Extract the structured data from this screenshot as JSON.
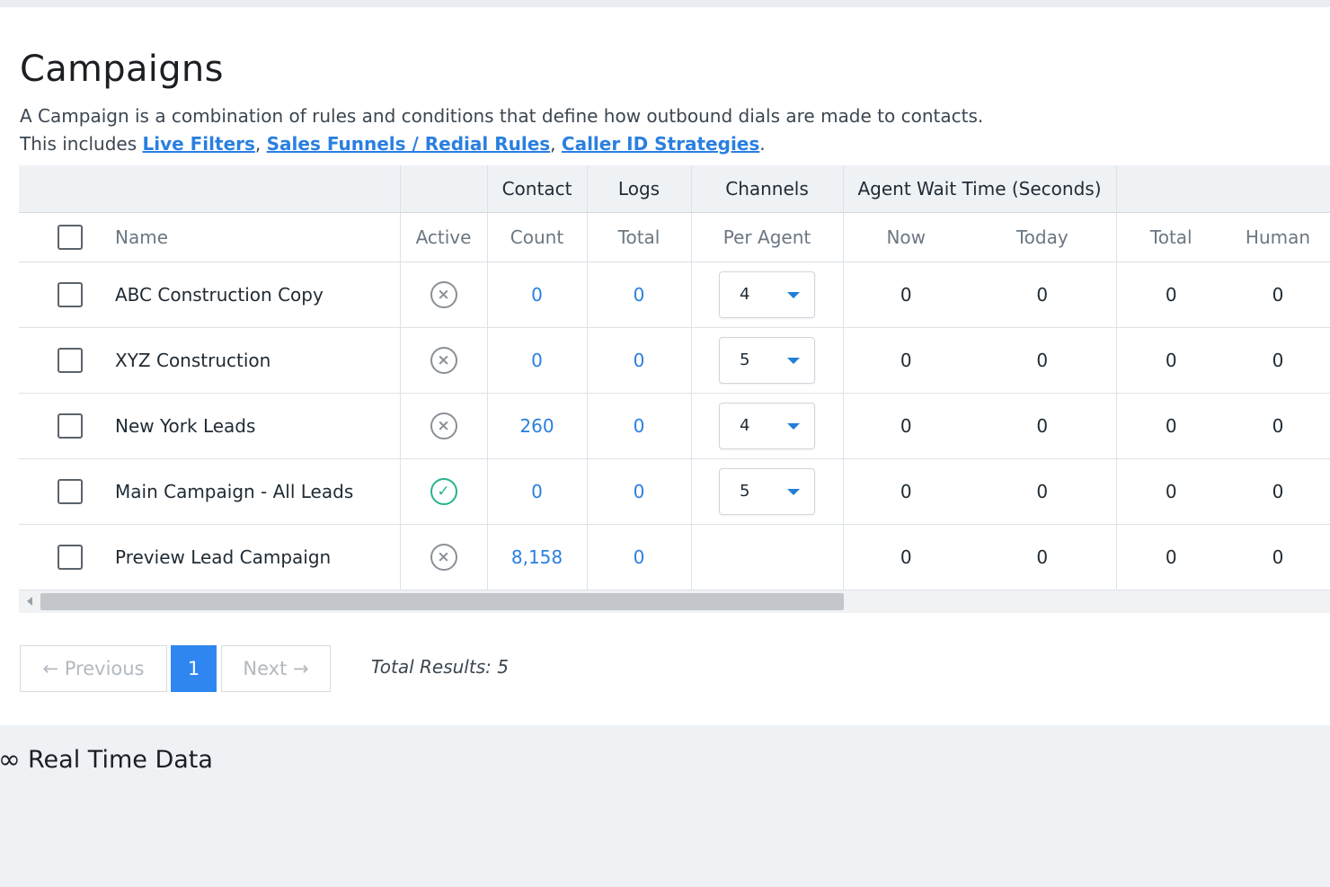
{
  "page": {
    "title": "Campaigns",
    "description_line1": "A Campaign is a combination of rules and conditions that define how outbound dials are made to contacts.",
    "description_prefix": "This includes",
    "links": [
      "Live Filters",
      "Sales Funnels / Redial Rules",
      "Caller ID Strategies"
    ]
  },
  "table": {
    "group_headers": {
      "contact": "Contact",
      "logs": "Logs",
      "channels": "Channels",
      "agent_wait": "Agent Wait Time (Seconds)"
    },
    "column_headers": {
      "name": "Name",
      "active": "Active",
      "count": "Count",
      "total": "Total",
      "per_agent": "Per Agent",
      "now": "Now",
      "today": "Today",
      "total2": "Total",
      "human": "Human"
    },
    "rows": [
      {
        "name": "ABC Construction Copy",
        "active": false,
        "contact_count": "0",
        "logs_total": "0",
        "per_agent": "4",
        "now": "0",
        "today": "0",
        "total": "0",
        "human": "0"
      },
      {
        "name": "XYZ Construction",
        "active": false,
        "contact_count": "0",
        "logs_total": "0",
        "per_agent": "5",
        "now": "0",
        "today": "0",
        "total": "0",
        "human": "0"
      },
      {
        "name": "New York Leads",
        "active": false,
        "contact_count": "260",
        "logs_total": "0",
        "per_agent": "4",
        "now": "0",
        "today": "0",
        "total": "0",
        "human": "0"
      },
      {
        "name": "Main Campaign - All Leads",
        "active": true,
        "contact_count": "0",
        "logs_total": "0",
        "per_agent": "5",
        "now": "0",
        "today": "0",
        "total": "0",
        "human": "0"
      },
      {
        "name": "Preview Lead Campaign",
        "active": false,
        "contact_count": "8,158",
        "logs_total": "0",
        "per_agent": "",
        "now": "0",
        "today": "0",
        "total": "0",
        "human": "0"
      }
    ]
  },
  "pagination": {
    "previous": "← Previous",
    "current": "1",
    "next": "Next →",
    "total_results": "Total Results: 5"
  },
  "footer": {
    "section_title": "Real Time Data"
  },
  "colors": {
    "link": "#2a7fe0",
    "active_page": "#2f86f0",
    "active_status": "#26b38f"
  }
}
